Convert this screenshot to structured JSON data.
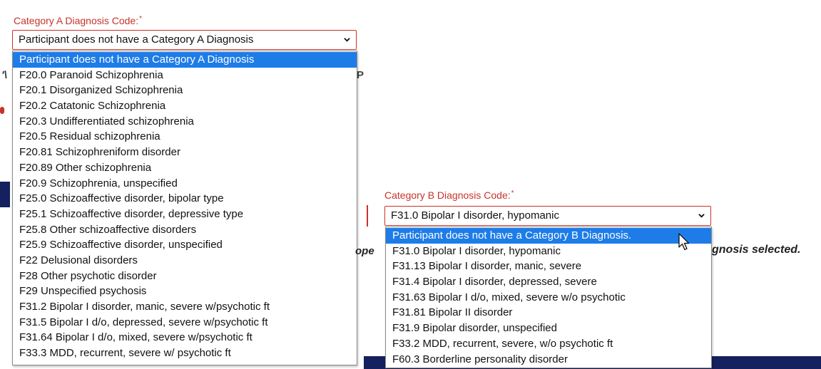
{
  "category_a": {
    "label": "Category A Diagnosis Code:",
    "required_mark": "*",
    "selected_value": "Participant does not have a Category A Diagnosis",
    "options": [
      "Participant does not have a Category A Diagnosis",
      "F20.0 Paranoid Schizophrenia",
      "F20.1 Disorganized Schizophrenia",
      "F20.2 Catatonic Schizophrenia",
      "F20.3 Undifferentiated schizophrenia",
      "F20.5 Residual schizophrenia",
      "F20.81 Schizophreniform disorder",
      "F20.89 Other schizophrenia",
      "F20.9 Schizophrenia, unspecified",
      "F25.0 Schizoaffective disorder, bipolar type",
      "F25.1 Schizoaffective disorder, depressive type",
      "F25.8 Other schizoaffective disorders",
      "F25.9 Schizoaffective disorder, unspecified",
      "F22 Delusional disorders",
      "F28 Other psychotic disorder",
      "F29 Unspecified psychosis",
      "F31.2 Bipolar I disorder, manic, severe w/psychotic ft",
      "F31.5 Bipolar I d/o, depressed, severe w/psychotic ft",
      "F31.64 Bipolar I d/o, mixed, severe w/psychotic ft",
      "F33.3 MDD, recurrent, severe w/ psychotic ft"
    ],
    "highlighted_index": 0
  },
  "category_b": {
    "label": "Category B Diagnosis Code:",
    "required_mark": "*",
    "selected_value": "F31.0 Bipolar I disorder, hypomanic",
    "options": [
      "Participant does not have a Category B Diagnosis.",
      "F31.0 Bipolar I disorder, hypomanic",
      "F31.13 Bipolar I disorder, manic, severe",
      "F31.4 Bipolar I disorder, depressed, severe",
      "F31.63 Bipolar I d/o, mixed, severe w/o psychotic",
      "F31.81 Bipolar II disorder",
      "F31.9 Bipolar disorder, unspecified",
      "F33.2 MDD, recurrent, severe, w/o psychotic ft",
      "F60.3 Borderline personality disorder"
    ],
    "highlighted_index": 0
  },
  "background_fragments": {
    "frag_ope": "ope",
    "frag_gnosis": "gnosis selected."
  },
  "colors": {
    "label_red": "#c8322b",
    "highlight_blue": "#1e7ce8",
    "navy": "#15205e"
  },
  "icons": {
    "dropdown_chevron": "chevron-down-icon",
    "mouse_cursor": "cursor-arrow-icon"
  }
}
